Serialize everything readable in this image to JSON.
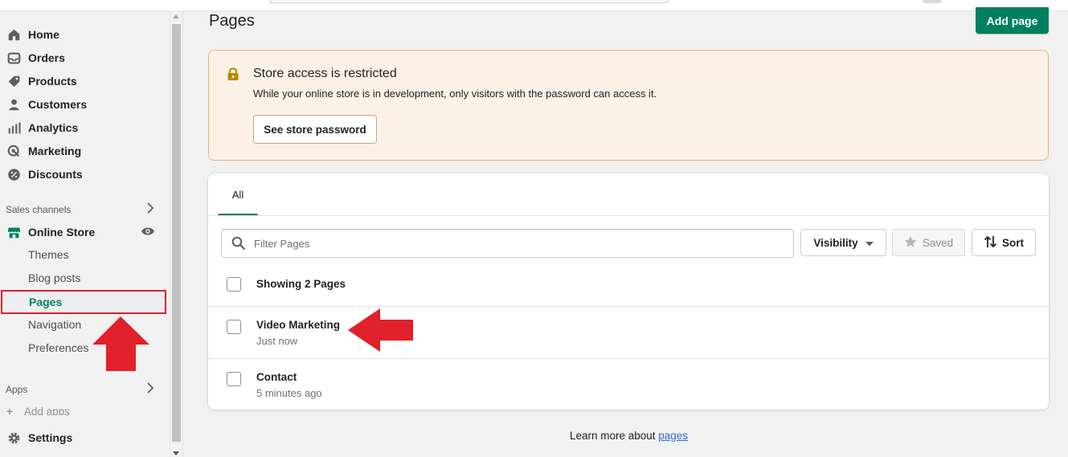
{
  "sidebar": {
    "items": [
      {
        "label": "Home",
        "icon": "home-icon"
      },
      {
        "label": "Orders",
        "icon": "inbox-icon"
      },
      {
        "label": "Products",
        "icon": "tag-icon"
      },
      {
        "label": "Customers",
        "icon": "person-icon"
      },
      {
        "label": "Analytics",
        "icon": "bar-chart-icon"
      },
      {
        "label": "Marketing",
        "icon": "target-icon"
      },
      {
        "label": "Discounts",
        "icon": "discount-icon"
      }
    ],
    "sales_channels_label": "Sales channels",
    "online_store": {
      "label": "Online Store",
      "icon": "store-icon"
    },
    "sub_items": [
      "Themes",
      "Blog posts",
      "Pages",
      "Navigation",
      "Preferences"
    ],
    "apps_label": "Apps",
    "add_apps": "Add apps",
    "settings": {
      "label": "Settings",
      "icon": "gear-icon"
    }
  },
  "main": {
    "title": "Pages",
    "add_page_label": "Add page",
    "banner": {
      "title": "Store access is restricted",
      "text": "While your online store is in development, only visitors with the password can access it.",
      "button": "See store password"
    },
    "tabs": [
      {
        "label": "All"
      }
    ],
    "filter": {
      "placeholder": "Filter Pages"
    },
    "visibility_label": "Visibility",
    "saved_label": "Saved",
    "sort_label": "Sort",
    "showing_label": "Showing 2 Pages",
    "pages": [
      {
        "title": "Video Marketing",
        "updated": "Just now"
      },
      {
        "title": "Contact",
        "updated": "5 minutes ago"
      }
    ],
    "footer": {
      "text": "Learn more about ",
      "link": "pages"
    }
  },
  "colors": {
    "accent": "#008060",
    "banner_bg": "#fcf1e6",
    "annotation": "#e0202a",
    "link": "#2c6ecb"
  }
}
